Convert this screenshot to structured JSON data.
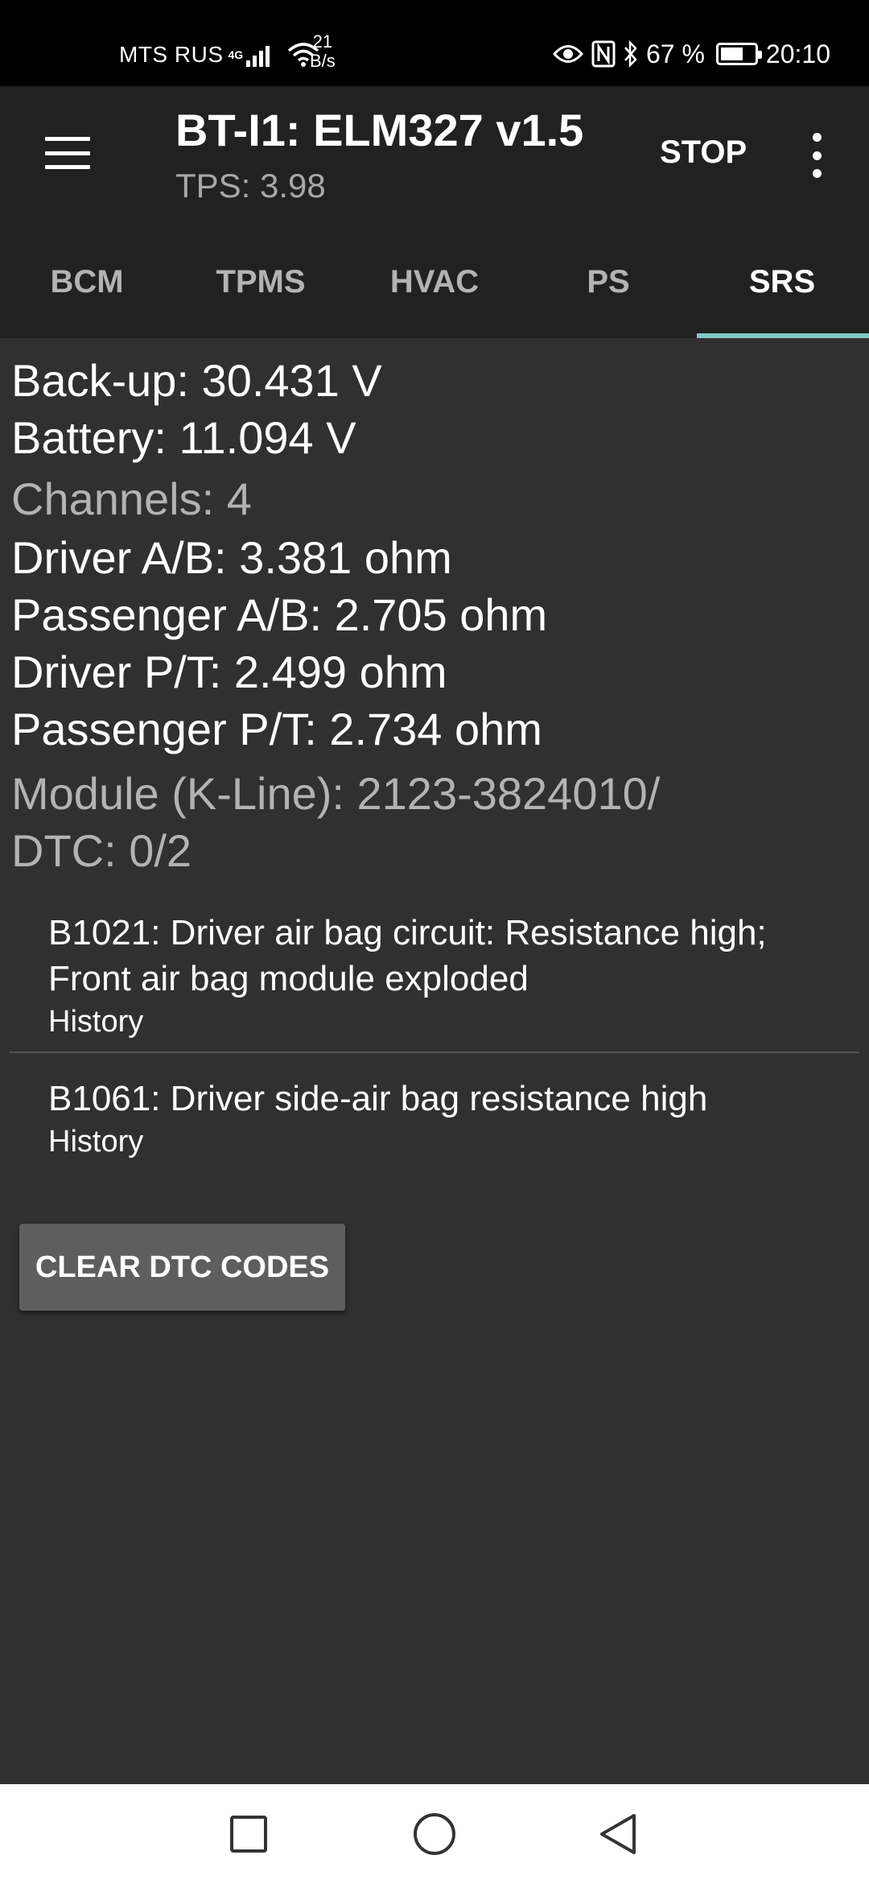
{
  "status_bar": {
    "carrier": "MTS RUS",
    "network_type": "4G",
    "speed_value": "21",
    "speed_unit": "B/s",
    "battery_percent": "67 %",
    "battery_level": 0.67,
    "time": "20:10"
  },
  "app_bar": {
    "title": "BT-I1: ELM327 v1.5",
    "subtitle": "TPS: 3.98",
    "stop_label": "STOP"
  },
  "tabs": [
    {
      "label": "BCM",
      "active": false
    },
    {
      "label": "TPMS",
      "active": false
    },
    {
      "label": "HVAC",
      "active": false
    },
    {
      "label": "PS",
      "active": false
    },
    {
      "label": "SRS",
      "active": true
    }
  ],
  "readings": {
    "backup": "Back-up: 30.431 V",
    "battery": "Battery: 11.094 V",
    "channels": "Channels: 4",
    "driver_ab": "Driver A/B: 3.381 ohm",
    "passenger_ab": "Passenger A/B: 2.705 ohm",
    "driver_pt": "Driver P/T: 2.499 ohm",
    "passenger_pt": "Passenger P/T: 2.734 ohm",
    "module": "Module (K-Line): 2123-3824010/",
    "dtc_count": "DTC: 0/2"
  },
  "dtc_list": [
    {
      "text": "B1021: Driver air bag  circuit: Resistance high; Front air bag module exploded",
      "status": "History"
    },
    {
      "text": "B1061: Driver side-air bag resistance high",
      "status": "History"
    }
  ],
  "clear_button_label": "CLEAR DTC CODES"
}
